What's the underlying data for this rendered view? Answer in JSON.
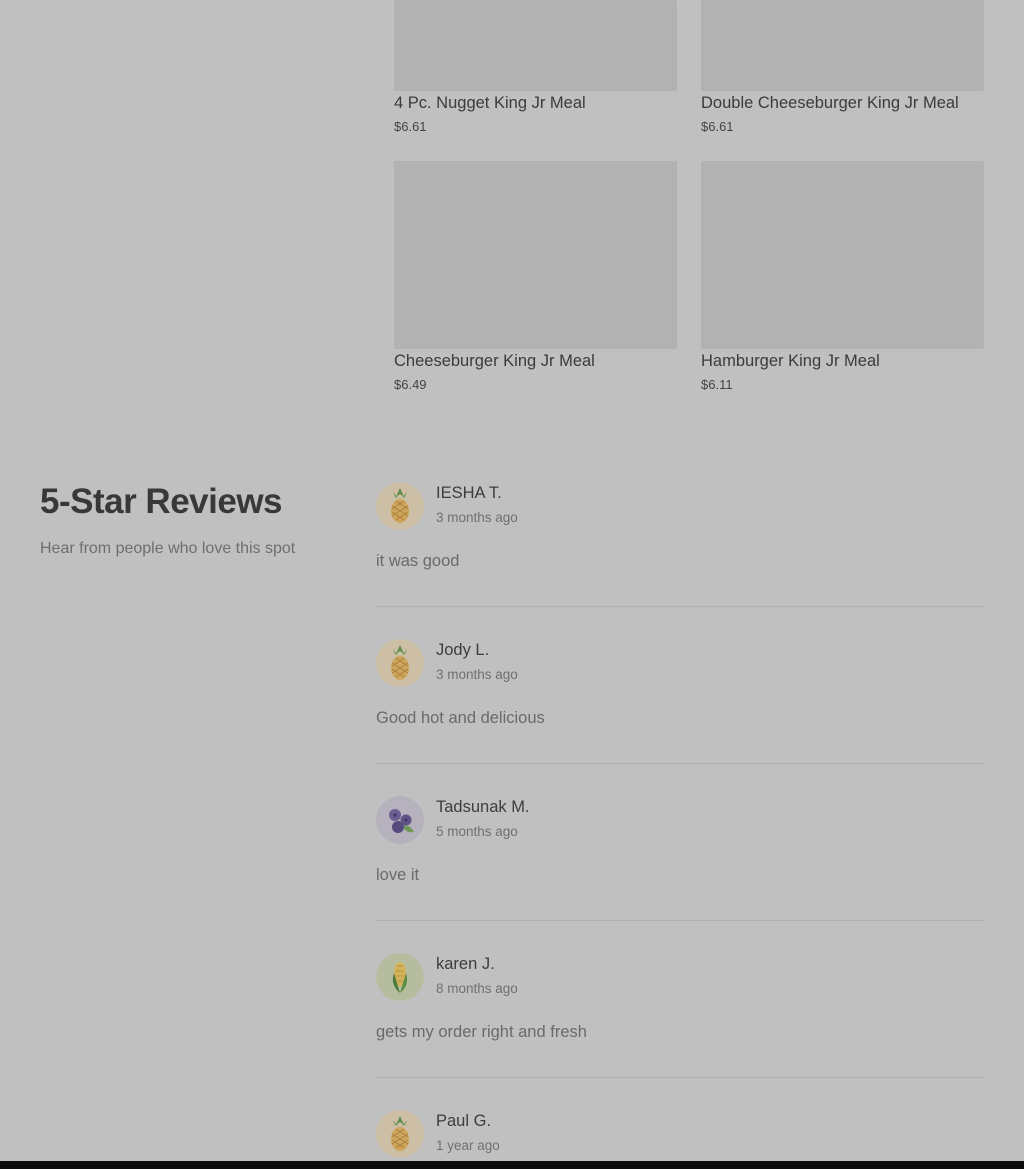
{
  "menu": {
    "items": [
      {
        "name": "4 Pc. Nugget King Jr Meal",
        "price": "$6.61"
      },
      {
        "name": "Double Cheeseburger King Jr Meal",
        "price": "$6.61"
      },
      {
        "name": "Cheeseburger King Jr Meal",
        "price": "$6.49"
      },
      {
        "name": "Hamburger King Jr Meal",
        "price": "$6.11"
      }
    ]
  },
  "reviews": {
    "heading": "5-Star Reviews",
    "subheading": "Hear from people who love this spot",
    "items": [
      {
        "name": "IESHA T.",
        "time": "3 months ago",
        "text": "it was good",
        "avatar_icon": "pineapple-icon"
      },
      {
        "name": "Jody L.",
        "time": "3 months ago",
        "text": "Good hot and delicious",
        "avatar_icon": "pineapple-icon"
      },
      {
        "name": "Tadsunak M.",
        "time": "5 months ago",
        "text": "love it",
        "avatar_icon": "blueberry-icon"
      },
      {
        "name": "karen J.",
        "time": "8 months ago",
        "text": "gets my order right and fresh",
        "avatar_icon": "corn-icon"
      },
      {
        "name": "Paul G.",
        "time": "1 year ago",
        "text": "",
        "avatar_icon": "pineapple-icon"
      }
    ]
  },
  "colors": {
    "overlay_background": "#c0c0c0",
    "image_placeholder": "#b2b2b2",
    "bottom_bar": "#0c0c0c"
  }
}
